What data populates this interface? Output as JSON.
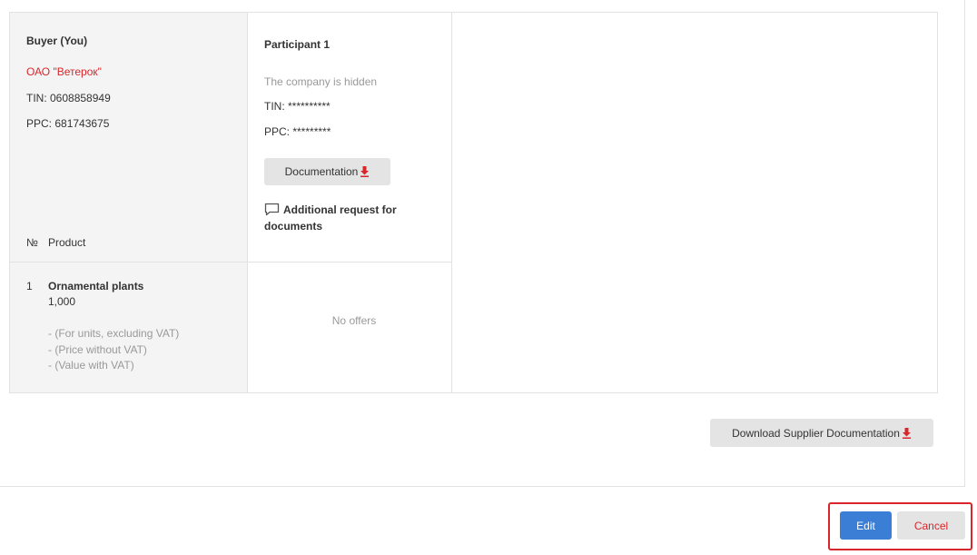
{
  "colors": {
    "accent_red": "#d9262b",
    "primary_blue": "#3a7fd5",
    "muted_text": "#999999",
    "button_gray": "#e4e4e4"
  },
  "buyer": {
    "title": "Buyer (You)",
    "company": "ОАО \"Ветерок\"",
    "tin": "TIN: 0608858949",
    "ppc": "PPC: 681743675"
  },
  "table": {
    "col_no": "№",
    "col_product": "Product",
    "rows": [
      {
        "no": "1",
        "product": "Ornamental plants",
        "quantity": "1,000",
        "lines": [
          "- (For units, excluding VAT)",
          "- (Price without VAT)",
          "- (Value with VAT)"
        ]
      }
    ]
  },
  "participant": {
    "title": "Participant 1",
    "hidden_text": "The company is hidden",
    "tin": "TIN: **********",
    "ppc": "PPC: *********",
    "documentation_label": "Documentation",
    "documentation_icon": "download-arrow-icon",
    "additional_request": "Additional request for documents",
    "additional_request_icon": "chat-icon",
    "no_offers": "No offers"
  },
  "footer": {
    "download_supplier_label": "Download Supplier Documentation",
    "edit_label": "Edit",
    "cancel_label": "Cancel"
  }
}
